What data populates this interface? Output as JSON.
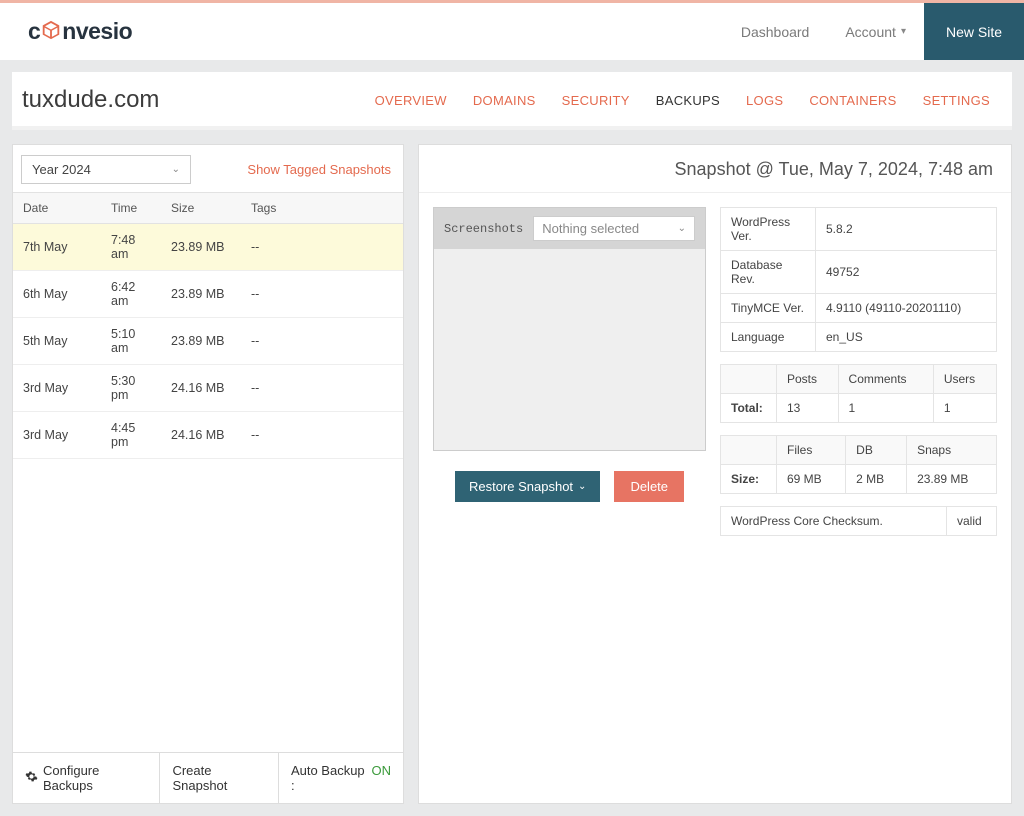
{
  "topbar": {
    "brand_prefix": "c",
    "brand_suffix": "nvesio",
    "dashboard": "Dashboard",
    "account": "Account",
    "new_site": "New Site"
  },
  "site": {
    "title": "tuxdude.com"
  },
  "tabs": {
    "overview": "OVERVIEW",
    "domains": "DOMAINS",
    "security": "SECURITY",
    "backups": "BACKUPS",
    "logs": "LOGS",
    "containers": "CONTAINERS",
    "settings": "SETTINGS"
  },
  "left": {
    "year": "Year 2024",
    "show_tagged": "Show Tagged Snapshots",
    "headers": {
      "date": "Date",
      "time": "Time",
      "size": "Size",
      "tags": "Tags"
    },
    "rows": [
      {
        "date": "7th May",
        "time": "7:48 am",
        "size": "23.89 MB",
        "tags": "--"
      },
      {
        "date": "6th May",
        "time": "6:42 am",
        "size": "23.89 MB",
        "tags": "--"
      },
      {
        "date": "5th May",
        "time": "5:10 am",
        "size": "23.89 MB",
        "tags": "--"
      },
      {
        "date": "3rd May",
        "time": "5:30 pm",
        "size": "24.16 MB",
        "tags": "--"
      },
      {
        "date": "3rd May",
        "time": "4:45 pm",
        "size": "24.16 MB",
        "tags": "--"
      }
    ],
    "configure": "Configure Backups",
    "create": "Create Snapshot",
    "auto_label": "Auto Backup :",
    "auto_state": "ON"
  },
  "right": {
    "title": "Snapshot @ Tue, May 7, 2024, 7:48 am",
    "screenshots_label": "Screenshots",
    "screenshots_placeholder": "Nothing selected",
    "meta": {
      "wp_ver_lbl": "WordPress Ver.",
      "wp_ver": "5.8.2",
      "db_rev_lbl": "Database Rev.",
      "db_rev": "49752",
      "tiny_lbl": "TinyMCE Ver.",
      "tiny": "4.9110 (49110-20201110)",
      "lang_lbl": "Language",
      "lang": "en_US"
    },
    "stats": {
      "posts_h": "Posts",
      "comments_h": "Comments",
      "users_h": "Users",
      "total_lbl": "Total:",
      "posts": "13",
      "comments": "1",
      "users": "1"
    },
    "sizes": {
      "files_h": "Files",
      "db_h": "DB",
      "snaps_h": "Snaps",
      "size_lbl": "Size:",
      "files": "69 MB",
      "db": "2 MB",
      "snaps": "23.89 MB"
    },
    "checksum_lbl": "WordPress Core Checksum.",
    "checksum_val": "valid",
    "restore": "Restore Snapshot",
    "delete": "Delete"
  }
}
